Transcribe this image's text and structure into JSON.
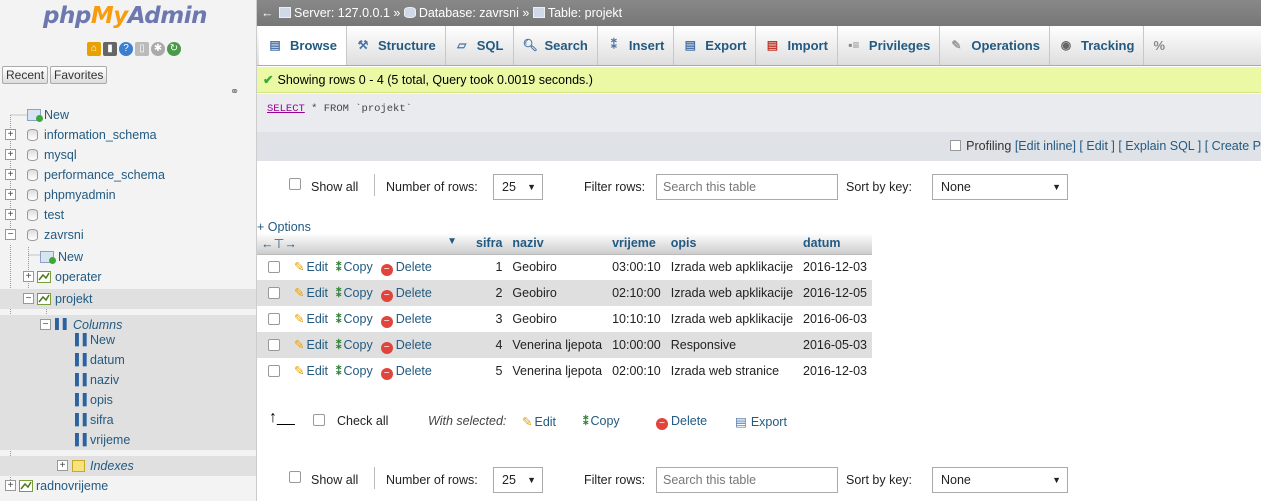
{
  "sidebar": {
    "logo_php": "php",
    "logo_my": "My",
    "logo_admin": "Admin",
    "recent_label": "Recent",
    "favorites_label": "Favorites",
    "tree": [
      {
        "label": "New"
      },
      {
        "label": "information_schema"
      },
      {
        "label": "mysql"
      },
      {
        "label": "performance_schema"
      },
      {
        "label": "phpmyadmin"
      },
      {
        "label": "test"
      },
      {
        "label": "zavrsni"
      },
      {
        "label": "New"
      },
      {
        "label": "operater"
      },
      {
        "label": "projekt"
      },
      {
        "label": "Columns"
      },
      {
        "label": "New"
      },
      {
        "label": "datum"
      },
      {
        "label": "naziv"
      },
      {
        "label": "opis"
      },
      {
        "label": "sifra"
      },
      {
        "label": "vrijeme"
      },
      {
        "label": "Indexes"
      },
      {
        "label": "radnovrijeme"
      }
    ]
  },
  "breadcrumb": {
    "server": "Server: 127.0.0.1",
    "database": "Database: zavrsni",
    "table": "Table: projekt",
    "sep": "»"
  },
  "tabs": [
    {
      "label": "Browse",
      "icon": "browse-icon"
    },
    {
      "label": "Structure",
      "icon": "structure-icon"
    },
    {
      "label": "SQL",
      "icon": "sql-icon"
    },
    {
      "label": "Search",
      "icon": "search-icon"
    },
    {
      "label": "Insert",
      "icon": "insert-icon"
    },
    {
      "label": "Export",
      "icon": "export-icon"
    },
    {
      "label": "Import",
      "icon": "import-icon"
    },
    {
      "label": "Privileges",
      "icon": "privileges-icon"
    },
    {
      "label": "Operations",
      "icon": "operations-icon"
    },
    {
      "label": "Tracking",
      "icon": "tracking-icon"
    }
  ],
  "status": {
    "message": "Showing rows 0 - 4 (5 total, Query took 0.0019 seconds.)"
  },
  "sql": {
    "keyword": "SELECT",
    "rest": " * FROM `projekt`"
  },
  "profiling": {
    "label": "Profiling",
    "links": "[Edit inline] [ Edit ] [ Explain SQL ] [ Create P"
  },
  "nav": {
    "show_all": "Show all",
    "number_of_rows": "Number of rows:",
    "rows_value": "25",
    "filter_rows": "Filter rows:",
    "filter_placeholder": "Search this table",
    "sort_by_key": "Sort by key:",
    "sort_value": "None"
  },
  "options_label": "+ Options",
  "table": {
    "columns": [
      "sifra",
      "naziv",
      "vrijeme",
      "opis",
      "datum"
    ],
    "actions": {
      "edit": "Edit",
      "copy": "Copy",
      "delete": "Delete"
    },
    "rows": [
      [
        "1",
        "Geobiro",
        "03:00:10",
        "Izrada web apklikacije",
        "2016-12-03"
      ],
      [
        "2",
        "Geobiro",
        "02:10:00",
        "Izrada web apklikacije",
        "2016-12-05"
      ],
      [
        "3",
        "Geobiro",
        "10:10:10",
        "Izrada web apklikacije",
        "2016-06-03"
      ],
      [
        "4",
        "Venerina ljepota",
        "10:00:00",
        "Responsive",
        "2016-05-03"
      ],
      [
        "5",
        "Venerina ljepota",
        "02:00:10",
        "Izrada web stranice",
        "2016-12-03"
      ]
    ]
  },
  "bulk": {
    "check_all": "Check all",
    "with_selected": "With selected:",
    "edit": "Edit",
    "copy": "Copy",
    "delete": "Delete",
    "export": "Export"
  },
  "colors": {
    "link": "#235a81",
    "success_bg": "#ebf8a4",
    "topbar": "#808080"
  }
}
